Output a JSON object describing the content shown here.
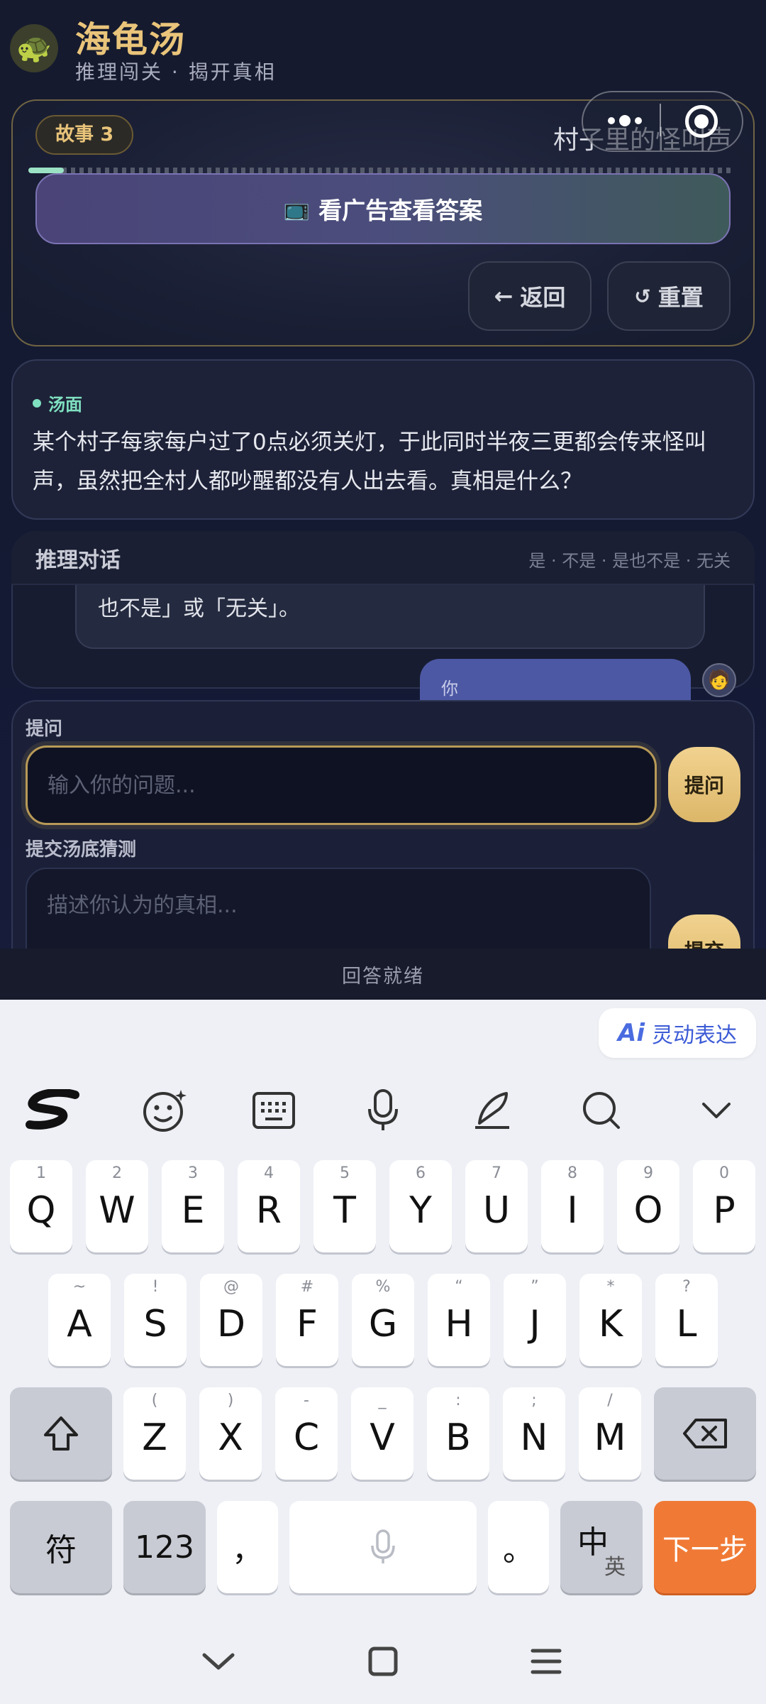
{
  "app": {
    "logo_emoji": "🐢",
    "title": "海龟汤",
    "subtitle": "推理闯关 · 揭开真相",
    "story_badge": "故事 3",
    "story_title": "村子里的怪叫声",
    "progress_fraction": 0.05,
    "ad_button": "看广告查看答案",
    "ad_icon": "📺",
    "back_button": "返回",
    "back_icon": "←",
    "reset_button": "重置",
    "reset_icon": "↺"
  },
  "soup": {
    "label": "汤面",
    "text": "某个村子每家每户过了0点必须关灯，于此同时半夜三更都会传来怪叫声，虽然把全村人都吵醒都没有人出去看。真相是什么？"
  },
  "dialog": {
    "title": "推理对话",
    "hint": "是 · 不是 · 是也不是 · 无关",
    "assistant_message_tail": "也不是」或「无关」。",
    "user_message_head": "你",
    "user_avatar": "🧑"
  },
  "ask": {
    "label": "提问",
    "placeholder": "输入你的问题...",
    "button": "提问"
  },
  "guess": {
    "label": "提交汤底猜测",
    "placeholder": "描述你认为的真相...",
    "button": "提交"
  },
  "status": "回答就绪",
  "keyboard": {
    "ai_chip_mark": "Ai",
    "ai_chip_label": "灵动表达",
    "toolbar_icons": [
      "swype-logo-icon",
      "emoji-icon",
      "keyboard-layout-icon",
      "microphone-icon",
      "handwriting-icon",
      "search-icon",
      "collapse-chevron-icon"
    ],
    "row1": [
      {
        "sub": "1",
        "main": "Q"
      },
      {
        "sub": "2",
        "main": "W"
      },
      {
        "sub": "3",
        "main": "E"
      },
      {
        "sub": "4",
        "main": "R"
      },
      {
        "sub": "5",
        "main": "T"
      },
      {
        "sub": "6",
        "main": "Y"
      },
      {
        "sub": "7",
        "main": "U"
      },
      {
        "sub": "8",
        "main": "I"
      },
      {
        "sub": "9",
        "main": "O"
      },
      {
        "sub": "0",
        "main": "P"
      }
    ],
    "row2": [
      {
        "sub": "~",
        "main": "A"
      },
      {
        "sub": "!",
        "main": "S"
      },
      {
        "sub": "@",
        "main": "D"
      },
      {
        "sub": "#",
        "main": "F"
      },
      {
        "sub": "%",
        "main": "G"
      },
      {
        "sub": "“",
        "main": "H"
      },
      {
        "sub": "”",
        "main": "J"
      },
      {
        "sub": "*",
        "main": "K"
      },
      {
        "sub": "?",
        "main": "L"
      }
    ],
    "row3": [
      {
        "sub": "(",
        "main": "Z"
      },
      {
        "sub": ")",
        "main": "X"
      },
      {
        "sub": "-",
        "main": "C"
      },
      {
        "sub": "_",
        "main": "V"
      },
      {
        "sub": ":",
        "main": "B"
      },
      {
        "sub": ";",
        "main": "N"
      },
      {
        "sub": "/",
        "main": "M"
      }
    ],
    "symbol_key": "符",
    "numeric_key": "123",
    "comma_key": "，",
    "period_key": "。",
    "lang_key_main": "中",
    "lang_key_sub": "英",
    "enter_key": "下一步"
  }
}
